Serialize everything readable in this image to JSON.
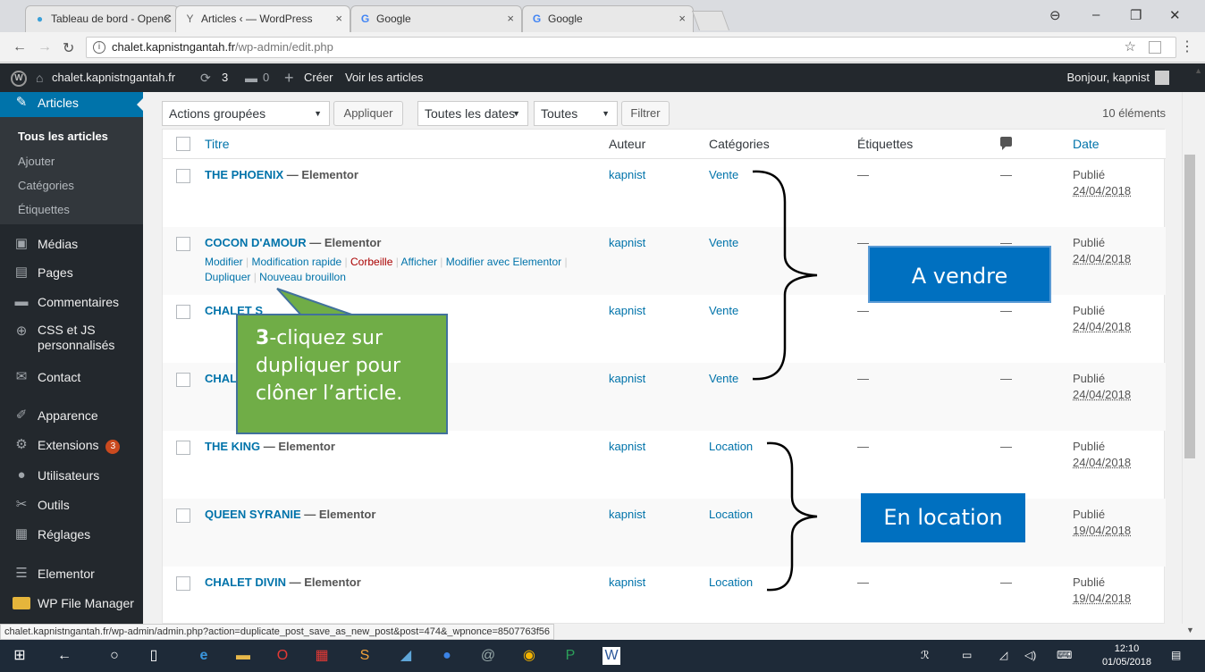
{
  "browser": {
    "tabs": [
      {
        "title": "Tableau de bord - OpenC",
        "icon": "opencart-icon"
      },
      {
        "title": "Articles ‹ — WordPress",
        "icon": "wordpress-tab-icon"
      },
      {
        "title": "Google",
        "icon": "google-icon"
      },
      {
        "title": "Google",
        "icon": "google-icon"
      }
    ],
    "url_host": "chalet.kapnistngantah.fr",
    "url_path": "/wp-admin/edit.php"
  },
  "adminbar": {
    "site_name": "chalet.kapnistngantah.fr",
    "updates_count": "3",
    "comments_count": "0",
    "new_label": "Créer",
    "view_posts_label": "Voir les articles",
    "greeting": "Bonjour, kapnist"
  },
  "sidebar": {
    "current": "Articles",
    "submenu": [
      "Tous les articles",
      "Ajouter",
      "Catégories",
      "Étiquettes"
    ],
    "items": [
      {
        "label": "Médias",
        "icon": "media-icon"
      },
      {
        "label": "Pages",
        "icon": "pages-icon"
      },
      {
        "label": "Commentaires",
        "icon": "comments-icon"
      },
      {
        "label": "CSS et JS personnalisés",
        "icon": "css-js-icon"
      },
      {
        "label": "Contact",
        "icon": "mail-icon"
      },
      {
        "label": "Apparence",
        "icon": "appearance-icon"
      },
      {
        "label": "Extensions",
        "icon": "plugins-icon",
        "badge": "3"
      },
      {
        "label": "Utilisateurs",
        "icon": "users-icon"
      },
      {
        "label": "Outils",
        "icon": "tools-icon"
      },
      {
        "label": "Réglages",
        "icon": "settings-icon"
      },
      {
        "label": "Elementor",
        "icon": "elementor-icon"
      },
      {
        "label": "WP File Manager",
        "icon": "folder-icon"
      }
    ]
  },
  "toolbar": {
    "bulk_actions": "Actions groupées",
    "apply": "Appliquer",
    "all_dates": "Toutes les dates",
    "all_categories": "Toutes",
    "filter": "Filtrer",
    "count": "10 éléments"
  },
  "table": {
    "headers": {
      "title": "Titre",
      "author": "Auteur",
      "categories": "Catégories",
      "tags": "Étiquettes",
      "date": "Date"
    },
    "state_suffix": " — Elementor",
    "row_actions": [
      "Modifier",
      "Modification rapide",
      "Corbeille",
      "Afficher",
      "Modifier avec Elementor",
      "Dupliquer",
      "Nouveau brouillon"
    ],
    "rows": [
      {
        "title": "THE PHOENIX",
        "author": "kapnist",
        "category": "Vente",
        "tags": "—",
        "comments": "—",
        "status": "Publié",
        "date": "24/04/2018"
      },
      {
        "title": "COCON D'AMOUR",
        "author": "kapnist",
        "category": "Vente",
        "tags": "—",
        "comments": "—",
        "status": "Publié",
        "date": "24/04/2018"
      },
      {
        "title": "CHALET S",
        "author": "kapnist",
        "category": "Vente",
        "tags": "—",
        "comments": "—",
        "status": "Publié",
        "date": "24/04/2018"
      },
      {
        "title": "CHAL",
        "author": "kapnist",
        "category": "Vente",
        "tags": "—",
        "comments": "—",
        "status": "Publié",
        "date": "24/04/2018"
      },
      {
        "title": "THE KING",
        "author": "kapnist",
        "category": "Location",
        "tags": "—",
        "comments": "—",
        "status": "Publié",
        "date": "24/04/2018"
      },
      {
        "title": "QUEEN SYRANIE",
        "author": "kapnist",
        "category": "Location",
        "tags": "—",
        "comments": "—",
        "status": "Publié",
        "date": "19/04/2018"
      },
      {
        "title": "CHALET DIVIN",
        "author": "kapnist",
        "category": "Location",
        "tags": "—",
        "comments": "—",
        "status": "Publié",
        "date": "19/04/2018"
      }
    ]
  },
  "annotations": {
    "for_sale": "A vendre",
    "for_rent": "En location",
    "note_number": "3",
    "note_text_1": "-cliquez sur",
    "note_text_2": "dupliquer pour",
    "note_text_3": "clôner l’article."
  },
  "status_url": "chalet.kapnistngantah.fr/wp-admin/admin.php?action=duplicate_post_save_as_new_post&post=474&_wpnonce=8507763f56",
  "taskbar": {
    "time": "12:10",
    "date": "01/05/2018"
  },
  "colors": {
    "wp_blue": "#0073aa",
    "admin_dark": "#23282d",
    "note_green": "#70ad47",
    "callout_blue": "#0070c0",
    "badge_orange": "#ca4a1f"
  }
}
